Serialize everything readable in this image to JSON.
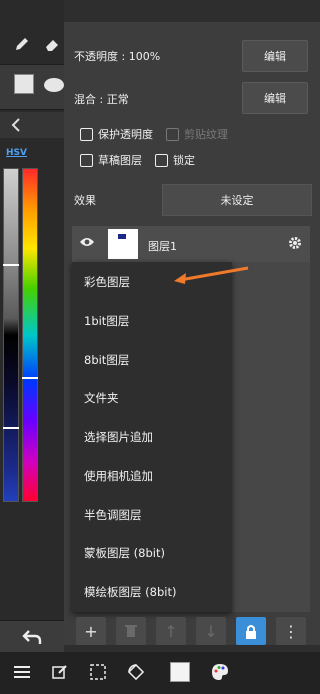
{
  "properties": {
    "opacity_label": "不透明度 : 100%",
    "blend_label": "混合 : 正常",
    "edit_label_1": "编辑",
    "edit_label_2": "编辑",
    "protect_alpha": "保护透明度",
    "clipping": "剪贴纹理",
    "draft_layer": "草稿图层",
    "lock": "锁定",
    "effect_label": "效果",
    "effect_value": "未设定"
  },
  "left_panel": {
    "hsv_tab": "HSV"
  },
  "layer": {
    "name": "图层1"
  },
  "add_layer_menu": {
    "items": [
      "彩色图层",
      "1bit图层",
      "8bit图层",
      "文件夹",
      "选择图片追加",
      "使用相机追加",
      "半色调图层",
      "蒙板图层 (8bit)",
      "模绘板图层 (8bit)"
    ]
  },
  "icons": {
    "pen": "pen-icon",
    "eraser": "eraser-icon",
    "visibility": "eye-icon",
    "settings": "gear-icon",
    "add": "plus-icon",
    "delete": "trash-icon",
    "move_up": "arrow-up-icon",
    "move_down": "arrow-down-icon",
    "lock": "lock-icon",
    "more": "more-vertical-icon",
    "menu": "hamburger-icon",
    "edit": "edit-icon",
    "selection": "selection-icon",
    "rotate": "rotate-icon",
    "canvas": "canvas-icon",
    "palette": "palette-icon",
    "undo": "undo-icon"
  },
  "colors": {
    "annotation_arrow": "#f07a2c",
    "lock_active": "#3a8fd8",
    "hsv_accent": "#4fa0f0"
  }
}
